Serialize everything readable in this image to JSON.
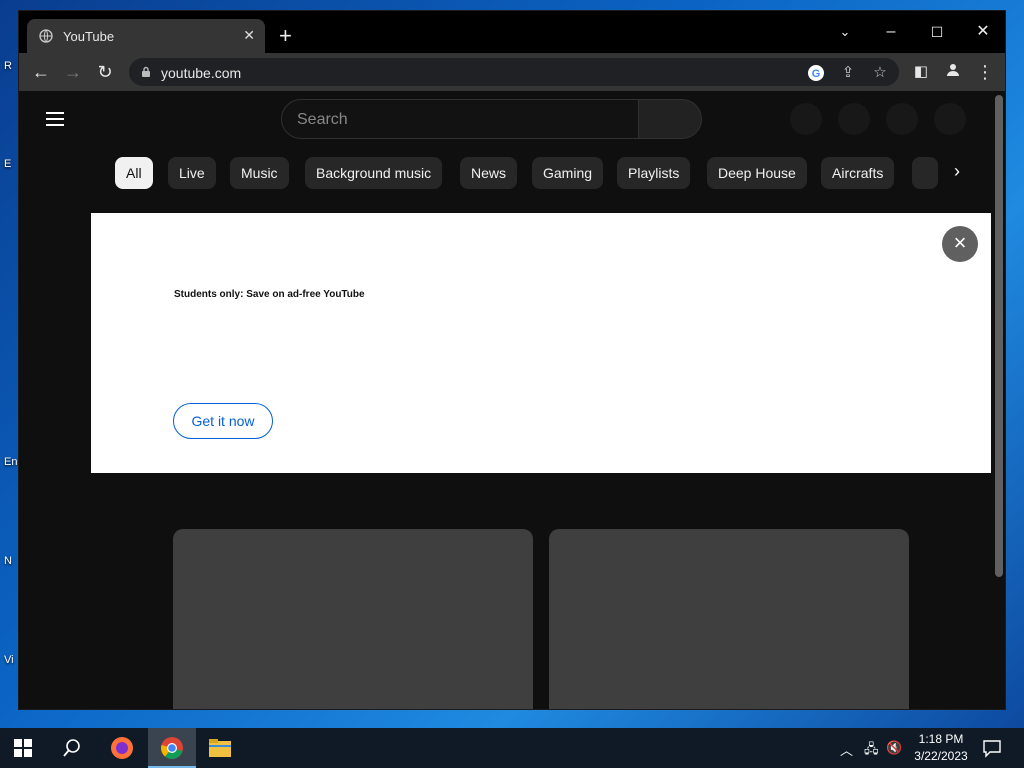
{
  "browser": {
    "tab_title": "YouTube",
    "url": "youtube.com"
  },
  "youtube": {
    "search_placeholder": "Search",
    "chips": [
      "All",
      "Live",
      "Music",
      "Background music",
      "News",
      "Gaming",
      "Playlists",
      "Deep House",
      "Aircrafts"
    ],
    "promo": {
      "text": "Students only:  Save on ad-free YouTube",
      "button_label": "Get it now"
    }
  },
  "desktop": {
    "labels": [
      "R",
      "E",
      "En",
      "N",
      "Vi"
    ]
  },
  "taskbar": {
    "time": "1:18 PM",
    "date": "3/22/2023"
  },
  "colors": {
    "youtube_bg": "#0f0f0f",
    "chip_bg": "#272727",
    "link_blue": "#065fd4",
    "taskbar_bg": "#101a26"
  }
}
